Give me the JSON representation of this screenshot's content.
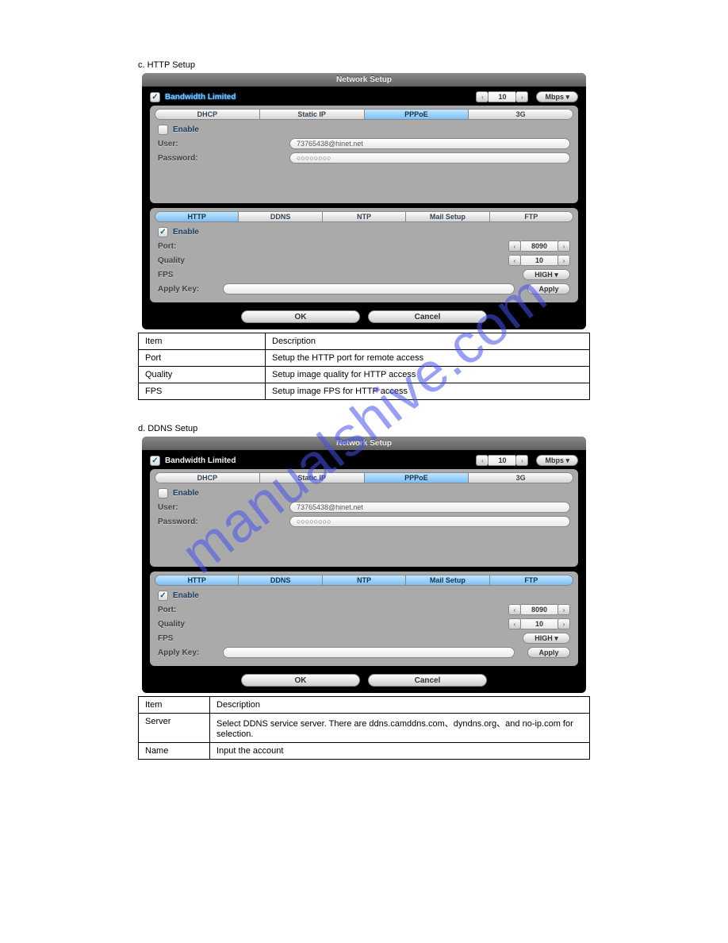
{
  "intro1": "c. HTTP Setup",
  "intro2": "d. DDNS Setup",
  "dlg1": {
    "title": "Network Setup",
    "bandwidth": "Bandwidth Limited",
    "bw_val": "10",
    "bw_unit": "Mbps",
    "conn_tabs": [
      "DHCP",
      "Static IP",
      "PPPoE",
      "3G"
    ],
    "conn_active": 2,
    "enable": "Enable",
    "user_label": "User:",
    "user_val": "73765438@hinet.net",
    "pass_label": "Password:",
    "pass_val": "○○○○○○○○",
    "svc_tabs": [
      "HTTP",
      "DDNS",
      "NTP",
      "Mail Setup",
      "FTP"
    ],
    "svc_active": 0,
    "svc_enable": "Enable",
    "port_label": "Port:",
    "port_val": "8090",
    "qual_label": "Quality",
    "qual_val": "10",
    "fps_label": "FPS",
    "fps_val": "HIGH",
    "apply_label": "Apply Key:",
    "apply_btn": "Apply",
    "ok": "OK",
    "cancel": "Cancel"
  },
  "dlg2": {
    "title": "Network Setup",
    "bandwidth": "Bandwidth Limited",
    "bw_val": "10",
    "bw_unit": "Mbps",
    "conn_tabs": [
      "DHCP",
      "Static IP",
      "PPPoE",
      "3G"
    ],
    "conn_active": 2,
    "enable": "Enable",
    "user_label": "User:",
    "user_val": "73765438@hinet.net",
    "pass_label": "Password:",
    "pass_val": "○○○○○○○○",
    "svc_tabs": [
      "HTTP",
      "DDNS",
      "NTP",
      "Mail Setup",
      "FTP"
    ],
    "svc_active": 1,
    "svc_enable": "Enable",
    "port_label": "Port:",
    "port_val": "8090",
    "qual_label": "Quality",
    "qual_val": "10",
    "fps_label": "FPS",
    "fps_val": "HIGH",
    "apply_label": "Apply Key:",
    "apply_btn": "Apply",
    "ok": "OK",
    "cancel": "Cancel"
  },
  "table1": {
    "r1c1": "Item",
    "r1c2": "Description",
    "r2c1": "Port",
    "r2c2": "Setup the HTTP port for remote access",
    "r3c1": "Quality",
    "r3c2": "Setup image quality for HTTP access",
    "r4c1": "FPS",
    "r4c2": "Setup image FPS for HTTP access"
  },
  "table2": {
    "r1c1": "Item",
    "r1c2": "Description",
    "r2c1": "Server",
    "r2c2": "Select DDNS service server. There are ddns.camddns.com、dyndns.org、and no-ip.com for selection.",
    "r3c1": "Name",
    "r3c2": "Input the account"
  }
}
